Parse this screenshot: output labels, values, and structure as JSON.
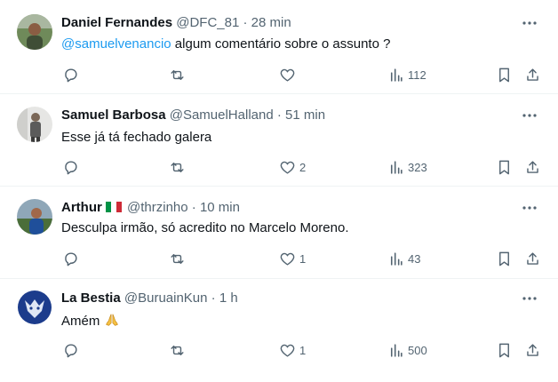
{
  "colors": {
    "text": "#0f1419",
    "secondary": "#536471",
    "link": "#1d9bf0",
    "divider": "#eff3f4"
  },
  "tweets": [
    {
      "name": "Daniel Fernandes",
      "handle": "@DFC_81",
      "dot": "·",
      "time": "28 min",
      "mention": "@samuelvenancio",
      "text": " algum comentário sobre o assunto ?",
      "likes": "",
      "views": "112"
    },
    {
      "name": "Samuel Barbosa",
      "handle": "@SamuelHalland",
      "dot": "·",
      "time": "51 min",
      "mention": "",
      "text": "Esse já tá fechado galera",
      "likes": "2",
      "views": "323"
    },
    {
      "name": "Arthur",
      "flag": "italy-flag",
      "handle": "@thrzinho",
      "dot": "·",
      "time": "10 min",
      "mention": "",
      "text": "Desculpa irmão, só acredito no Marcelo Moreno.",
      "likes": "1",
      "views": "43"
    },
    {
      "name": "La Bestia",
      "handle": "@BuruainKun",
      "dot": "·",
      "time": "1 h",
      "mention": "",
      "text": "Amém",
      "emoji": "folded-hands-icon",
      "likes": "1",
      "views": "500"
    }
  ]
}
